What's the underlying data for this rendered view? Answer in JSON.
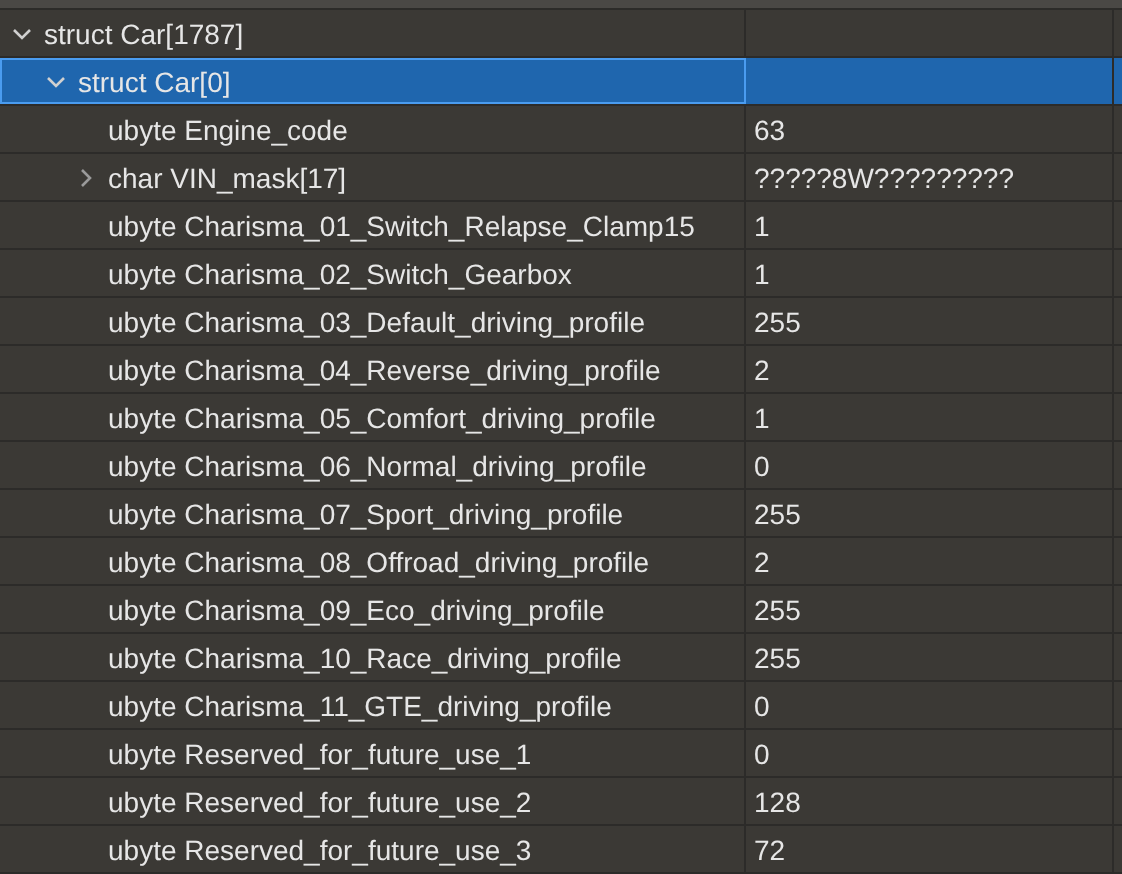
{
  "tree": [
    {
      "label": "struct Car[1787]",
      "expanded": true,
      "selected": false,
      "children": [
        {
          "label": "struct Car[0]",
          "expanded": true,
          "selected": true,
          "children": [
            {
              "label": "ubyte Engine_code",
              "value": "63",
              "selected": false
            },
            {
              "label": "char VIN_mask[17]",
              "value": "?????8W?????????",
              "expanded": false,
              "selected": false
            },
            {
              "label": "ubyte Charisma_01_Switch_Relapse_Clamp15",
              "value": "1",
              "selected": false
            },
            {
              "label": "ubyte Charisma_02_Switch_Gearbox",
              "value": "1",
              "selected": false
            },
            {
              "label": "ubyte Charisma_03_Default_driving_profile",
              "value": "255",
              "selected": false
            },
            {
              "label": "ubyte Charisma_04_Reverse_driving_profile",
              "value": "2",
              "selected": false
            },
            {
              "label": "ubyte Charisma_05_Comfort_driving_profile",
              "value": "1",
              "selected": false
            },
            {
              "label": "ubyte Charisma_06_Normal_driving_profile",
              "value": "0",
              "selected": false
            },
            {
              "label": "ubyte Charisma_07_Sport_driving_profile",
              "value": "255",
              "selected": false
            },
            {
              "label": "ubyte Charisma_08_Offroad_driving_profile",
              "value": "2",
              "selected": false
            },
            {
              "label": "ubyte Charisma_09_Eco_driving_profile",
              "value": "255",
              "selected": false
            },
            {
              "label": "ubyte Charisma_10_Race_driving_profile",
              "value": "255",
              "selected": false
            },
            {
              "label": "ubyte Charisma_11_GTE_driving_profile",
              "value": "0",
              "selected": false
            },
            {
              "label": "ubyte Reserved_for_future_use_1",
              "value": "0",
              "selected": false
            },
            {
              "label": "ubyte Reserved_for_future_use_2",
              "value": "128",
              "selected": false
            },
            {
              "label": "ubyte Reserved_for_future_use_3",
              "value": "72",
              "selected": false
            }
          ]
        }
      ]
    }
  ]
}
